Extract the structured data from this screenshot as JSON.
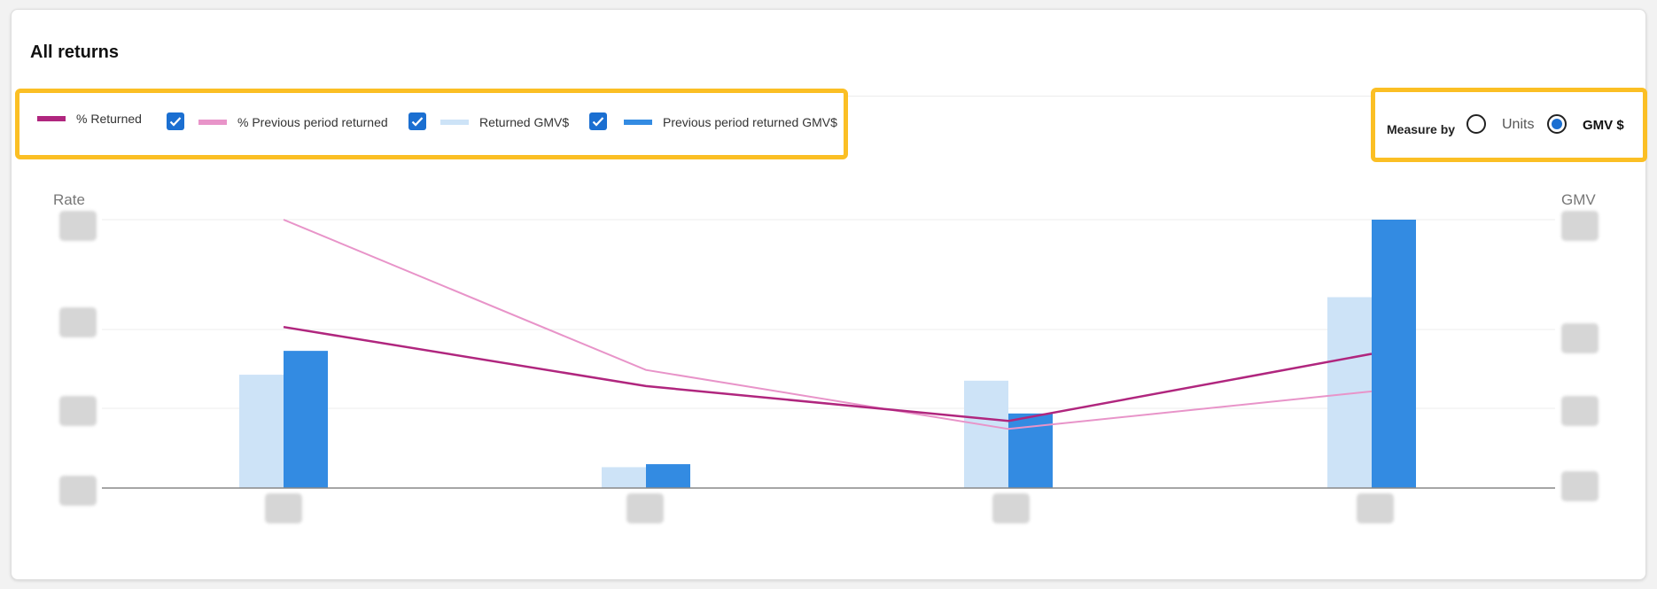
{
  "header": {
    "title": "All returns"
  },
  "legend": {
    "items": [
      {
        "label": "% Returned",
        "color": "#b0267e",
        "checked": true
      },
      {
        "label": "% Previous period returned",
        "color": "#e894c9",
        "checked": true
      },
      {
        "label": "Returned GMV$",
        "color": "#cde3f7",
        "checked": true
      },
      {
        "label": "Previous period returned GMV$",
        "color": "#338be2",
        "checked": false
      }
    ]
  },
  "measure": {
    "label": "Measure by",
    "options": [
      {
        "label": "Units",
        "selected": false
      },
      {
        "label": "GMV $",
        "selected": true
      }
    ]
  },
  "colors": {
    "highlight": "#fbbf24",
    "checkbox": "#1b6fd1"
  },
  "chart_data": {
    "type": "bar",
    "left_axis_title": "Rate",
    "right_axis_title": "GMV",
    "categories": [
      "",
      "",
      "",
      ""
    ],
    "series": [
      {
        "name": "Returned GMV$",
        "type": "bar",
        "axis": "right",
        "values": [
          38,
          7,
          36,
          64
        ]
      },
      {
        "name": "Previous period returned GMV$",
        "type": "bar",
        "axis": "right",
        "values": [
          46,
          8,
          25,
          90
        ]
      },
      {
        "name": "% Returned",
        "type": "line",
        "axis": "left",
        "values": [
          60,
          38,
          25,
          50
        ]
      },
      {
        "name": "% Previous period returned",
        "type": "line",
        "axis": "left",
        "values": [
          100,
          44,
          22,
          36
        ]
      }
    ],
    "ylim_left": [
      0,
      100
    ],
    "ylim_right": [
      0,
      90
    ],
    "tick_labels_obscured": true,
    "grid": true
  }
}
